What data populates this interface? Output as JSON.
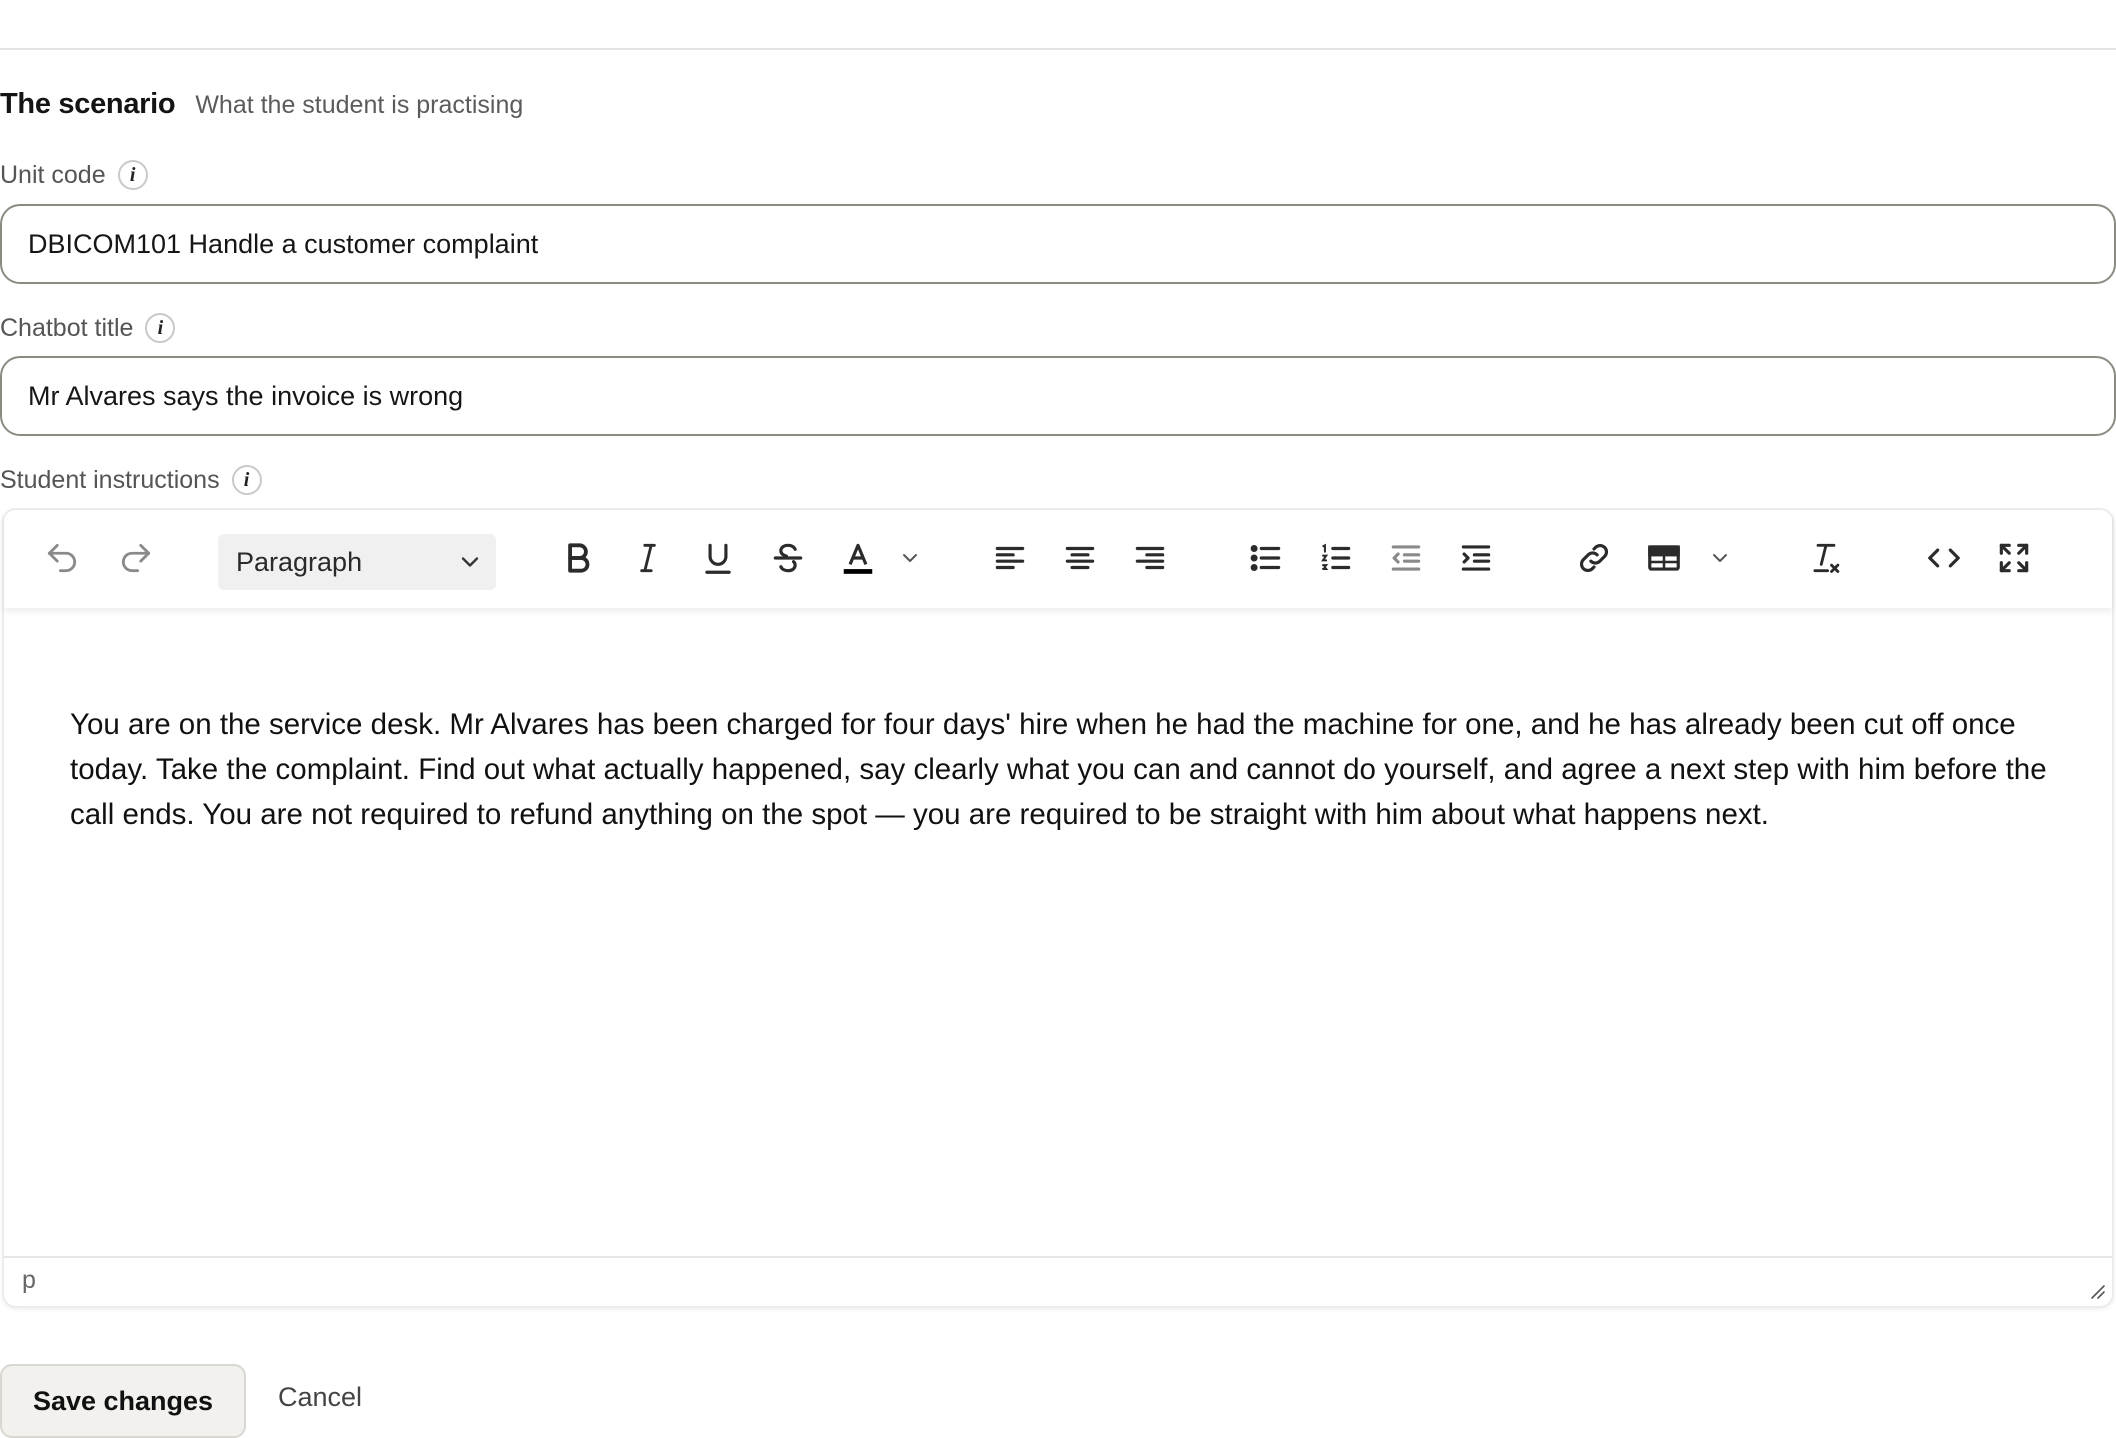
{
  "section": {
    "title": "The scenario",
    "subtitle": "What the student is practising"
  },
  "fields": {
    "unit_code": {
      "label": "Unit code",
      "value": "DBICOM101 Handle a customer complaint"
    },
    "chatbot_title": {
      "label": "Chatbot title",
      "value": "Mr Alvares says the invoice is wrong"
    },
    "student_instructions": {
      "label": "Student instructions"
    }
  },
  "info_icon_glyph": "i",
  "editor": {
    "block_format": "Paragraph",
    "content": "You are on the service desk. Mr Alvares has been charged for four days' hire when he had the machine for one, and he has already been cut off once today. Take the complaint. Find out what actually happened, say clearly what you can and cannot do yourself, and agree a next step with him before the call ends. You are not required to refund anything on the spot — you are required to be straight with him about what happens next.",
    "status_path": "p",
    "toolbar_icons": [
      "undo-icon",
      "redo-icon",
      "chevron-down-icon",
      "bold-icon",
      "italic-icon",
      "underline-icon",
      "strikethrough-icon",
      "text-color-icon",
      "align-left-icon",
      "align-center-icon",
      "align-right-icon",
      "bullet-list-icon",
      "numbered-list-icon",
      "outdent-icon",
      "indent-icon",
      "link-icon",
      "table-icon",
      "clear-formatting-icon",
      "source-code-icon",
      "fullscreen-icon"
    ],
    "text_color_swatch": "#000000"
  },
  "actions": {
    "save_label": "Save changes",
    "cancel_label": "Cancel"
  },
  "colors": {
    "input_border": "#8b8b80",
    "save_bg": "#f2f1ed",
    "icon_dark": "#2b2b2b",
    "icon_disabled": "#8a8a8a"
  }
}
